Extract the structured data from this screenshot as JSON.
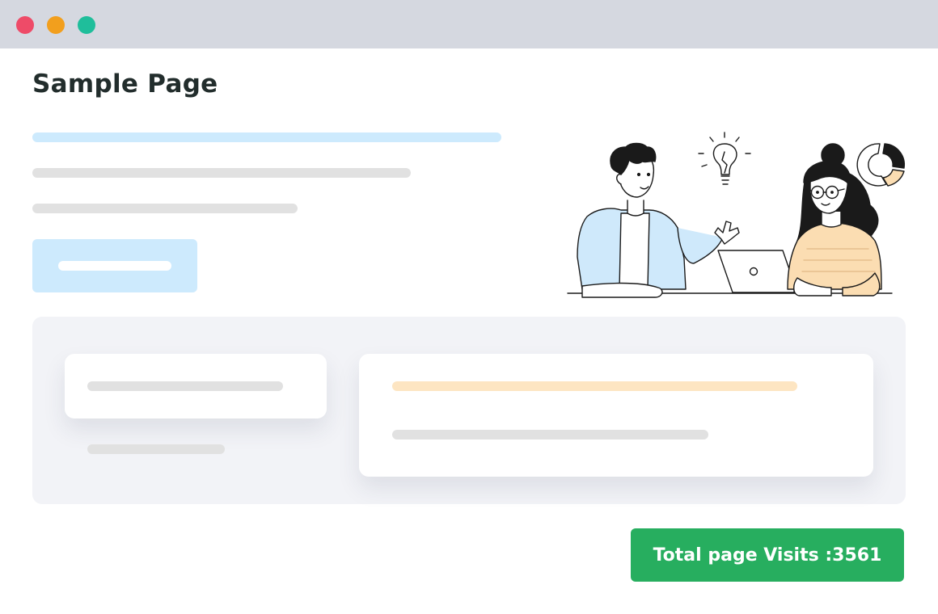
{
  "window": {
    "controls": [
      {
        "name": "close",
        "color": "#ee4b68"
      },
      {
        "name": "minimize",
        "color": "#f29f1d"
      },
      {
        "name": "maximize",
        "color": "#1fbe9b"
      }
    ]
  },
  "page": {
    "title": "Sample Page"
  },
  "illustration": {
    "icons": [
      "lightbulb-icon",
      "donut-chart-icon",
      "laptop-icon"
    ],
    "colors": {
      "man_shirt": "#cfe9fb",
      "woman_sweater": "#fbddb2",
      "chart_accent": "#fbddb2"
    }
  },
  "colors": {
    "placeholder_blue": "#cdeafd",
    "placeholder_gray": "#e1e1e1",
    "placeholder_orange": "#fde5c2",
    "panel_background": "#f2f3f7",
    "accent_green": "#27ae5f"
  },
  "stats": {
    "visits_label": "Total page Visits : ",
    "visits_count": "3561"
  }
}
